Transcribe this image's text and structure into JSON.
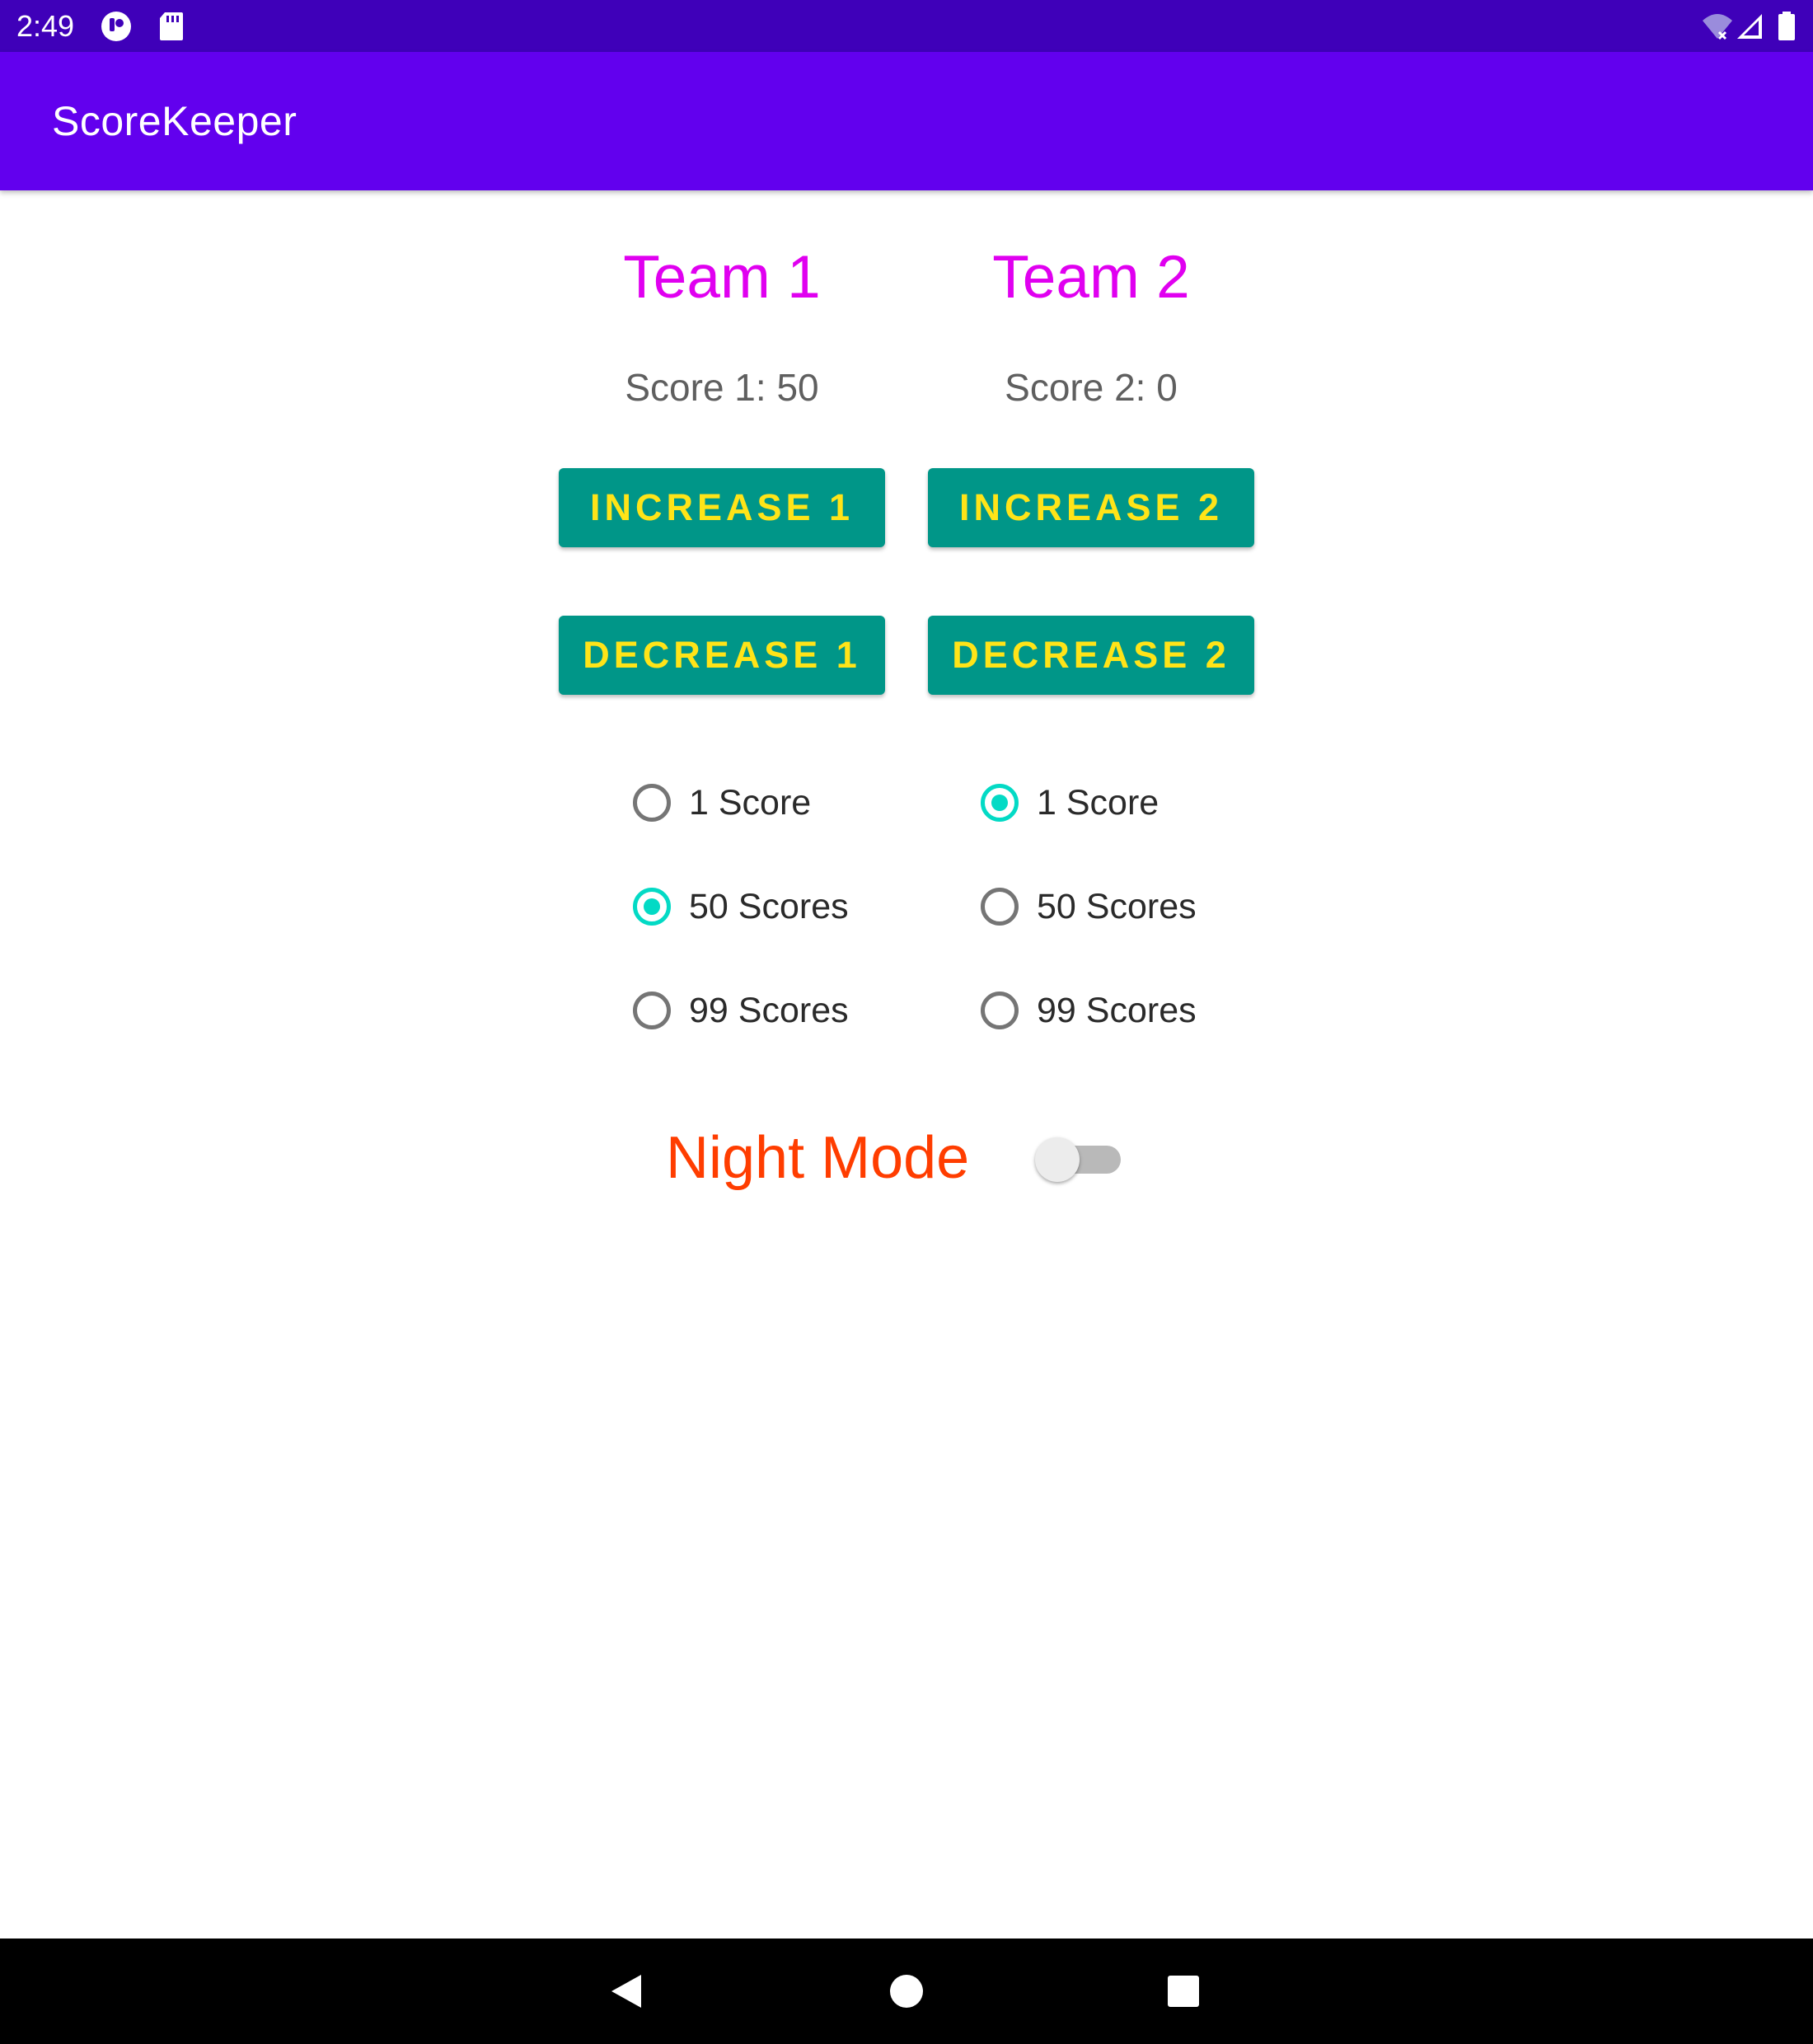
{
  "status_bar": {
    "time": "2:49",
    "left_icons": [
      "notification-app-icon",
      "sd-card-icon"
    ],
    "right_icons": [
      "wifi-off-icon",
      "cell-signal-icon",
      "battery-icon"
    ]
  },
  "app_bar": {
    "title": "ScoreKeeper"
  },
  "teams": [
    {
      "title": "Team 1",
      "score_text": "Score 1: 50",
      "increase_label": "INCREASE 1",
      "decrease_label": "DECREASE 1",
      "options": [
        {
          "label": "1 Score",
          "checked": false
        },
        {
          "label": "50 Scores",
          "checked": true
        },
        {
          "label": "99 Scores",
          "checked": false
        }
      ]
    },
    {
      "title": "Team 2",
      "score_text": "Score 2: 0",
      "increase_label": "INCREASE 2",
      "decrease_label": "DECREASE 2",
      "options": [
        {
          "label": "1 Score",
          "checked": true
        },
        {
          "label": "50 Scores",
          "checked": false
        },
        {
          "label": "99 Scores",
          "checked": false
        }
      ]
    }
  ],
  "night_mode": {
    "label": "Night Mode",
    "enabled": false
  },
  "nav_bar": {
    "buttons": [
      "back-icon",
      "home-icon",
      "recents-icon"
    ]
  },
  "colors": {
    "status_bar": "#3f00b9",
    "app_bar": "#6200ee",
    "team_title": "#e000f0",
    "button_bg": "#009688",
    "button_text": "#ffe418",
    "radio_accent": "#03dac5",
    "night_mode_label": "#ff3d00"
  }
}
